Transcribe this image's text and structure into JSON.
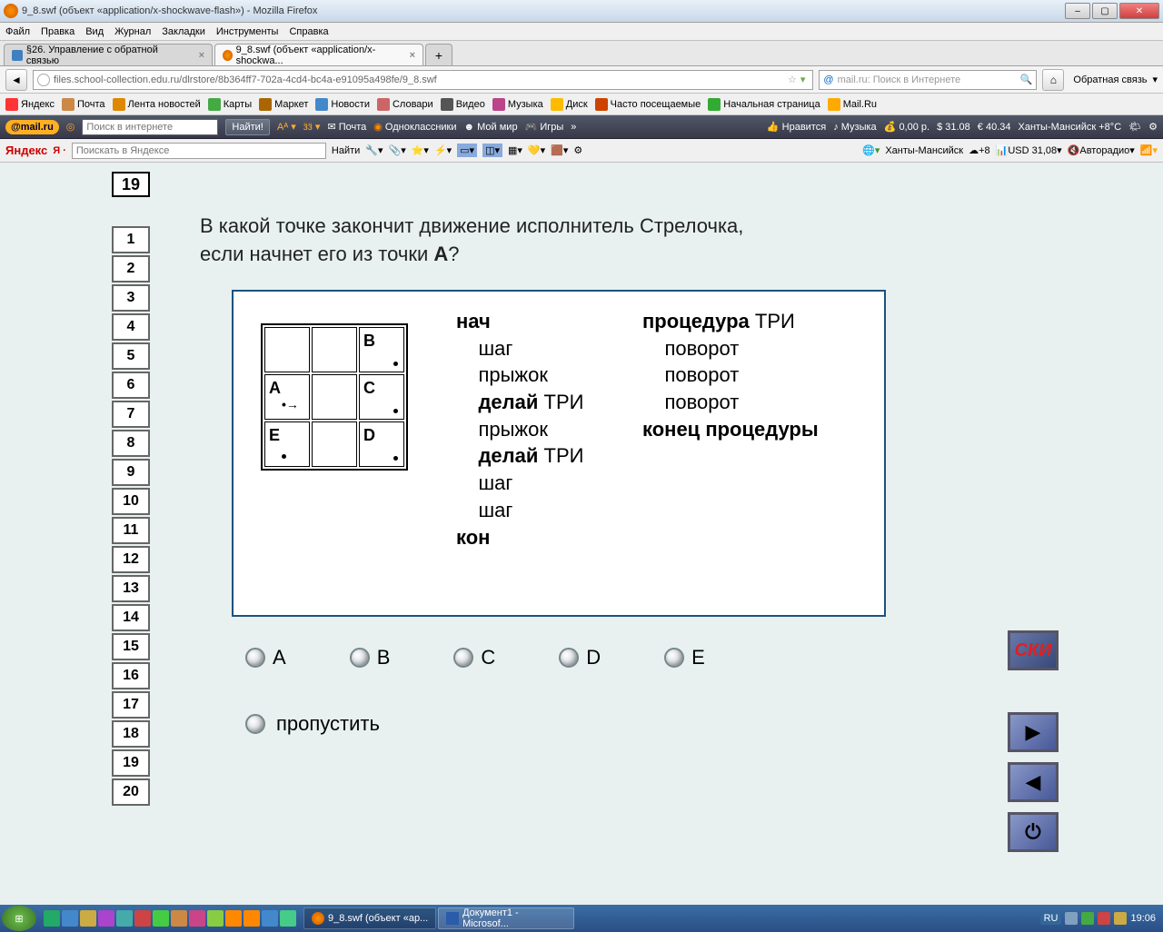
{
  "window": {
    "title": "9_8.swf (объект «application/x-shockwave-flash») - Mozilla Firefox"
  },
  "menu": {
    "file": "Файл",
    "edit": "Правка",
    "view": "Вид",
    "history": "Журнал",
    "bookmarks": "Закладки",
    "tools": "Инструменты",
    "help": "Справка"
  },
  "tabs": {
    "t1": "§26. Управление с обратной связью",
    "t2": "9_8.swf (объект «application/x-shockwa..."
  },
  "url": "files.school-collection.edu.ru/dlrstore/8b364ff7-702a-4cd4-bc4a-e91095a498fe/9_8.swf",
  "search": {
    "placeholder": "mail.ru: Поиск в Интернете"
  },
  "feedback": "Обратная связь",
  "toolbar1": {
    "yandex": "Яндекс",
    "mail": "Почта",
    "news": "Лента новостей",
    "maps": "Карты",
    "market": "Маркет",
    "novosti": "Новости",
    "slovari": "Словари",
    "video": "Видео",
    "music": "Музыка",
    "disk": "Диск",
    "visited": "Часто посещаемые",
    "startpage": "Начальная страница",
    "mailru": "Mail.Ru"
  },
  "mailbar": {
    "logo": "@mail.ru",
    "search_ph": "Поиск в интернете",
    "find": "Найти!",
    "mail": "Почта",
    "odno": "Одноклассники",
    "moimir": "Мой мир",
    "games": "Игры",
    "likes": "Нравится",
    "music": "Музыка",
    "money": "0,00 р.",
    "usd": "$ 31.08",
    "eur": "€ 40.34",
    "city": "Ханты-Мансийск +8°C"
  },
  "yandexbar": {
    "logo": "Яндекс",
    "search_ph": "Поискать в Яндексе",
    "find": "Найти",
    "city": "Ханты-Мансийск",
    "temp": "+8",
    "usd": "USD 31,08",
    "radio": "Авторадио"
  },
  "quiz": {
    "current": "19",
    "numbers": [
      "1",
      "2",
      "3",
      "4",
      "5",
      "6",
      "7",
      "8",
      "9",
      "10",
      "11",
      "12",
      "13",
      "14",
      "15",
      "16",
      "17",
      "18",
      "19",
      "20"
    ],
    "question_l1": "В какой точке закончит движение исполнитель Стрелочка,",
    "question_l2": "если начнет его из точки ",
    "question_bold": "A",
    "question_q": "?",
    "grid": {
      "B": "B",
      "A": "A",
      "C": "C",
      "E": "E",
      "D": "D"
    },
    "code1": {
      "nach": "нач",
      "step1": "шаг",
      "jump1": "прыжок",
      "do1": "делай",
      "tri": " ТРИ",
      "jump2": "прыжок",
      "do2": "делай",
      "step2": "шаг",
      "step3": "шаг",
      "kon": "кон"
    },
    "code2": {
      "proc": "процедура",
      "tri": " ТРИ",
      "turn": "поворот",
      "end": "конец процедуры"
    },
    "options": {
      "A": "A",
      "B": "B",
      "C": "C",
      "D": "D",
      "E": "E"
    },
    "skip": "пропустить",
    "ski": "СКИ"
  },
  "taskbar": {
    "app1": "9_8.swf (объект «ap...",
    "app2": "Документ1 - Microsof...",
    "time": "19:06",
    "lang": "RU"
  }
}
